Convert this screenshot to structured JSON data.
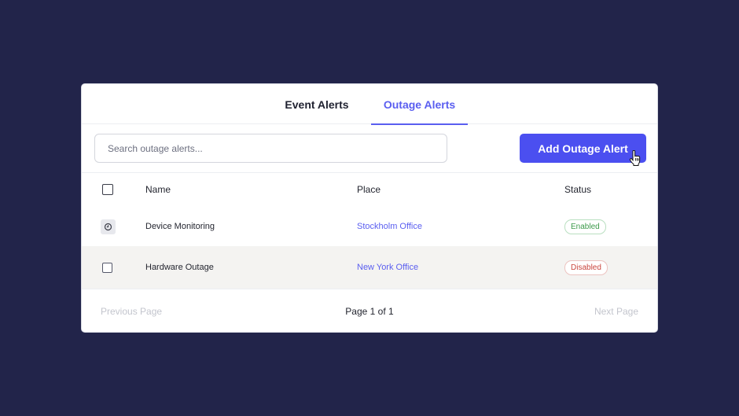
{
  "tabs": {
    "event": "Event Alerts",
    "outage": "Outage Alerts",
    "active": "Outage Alerts"
  },
  "toolbar": {
    "search_placeholder": "Search outage alerts...",
    "search_value": "",
    "add_label": "Add Outage Alert"
  },
  "table": {
    "headers": {
      "name": "Name",
      "place": "Place",
      "status": "Status"
    },
    "rows": [
      {
        "name": "Device Monitoring",
        "place": "Stockholm Office",
        "status": "Enabled",
        "icon": "clock-icon"
      },
      {
        "name": "Hardware Outage",
        "place": "New York Office",
        "status": "Disabled",
        "icon": "checkbox"
      }
    ]
  },
  "pagination": {
    "previous": "Previous Page",
    "info": "Page 1 of 1",
    "next": "Next Page"
  },
  "colors": {
    "background": "#22244a",
    "accent": "#4b4ff0",
    "tab_active": "#5a5ef0",
    "enabled": "#3c9a4a",
    "disabled": "#c9453d"
  }
}
